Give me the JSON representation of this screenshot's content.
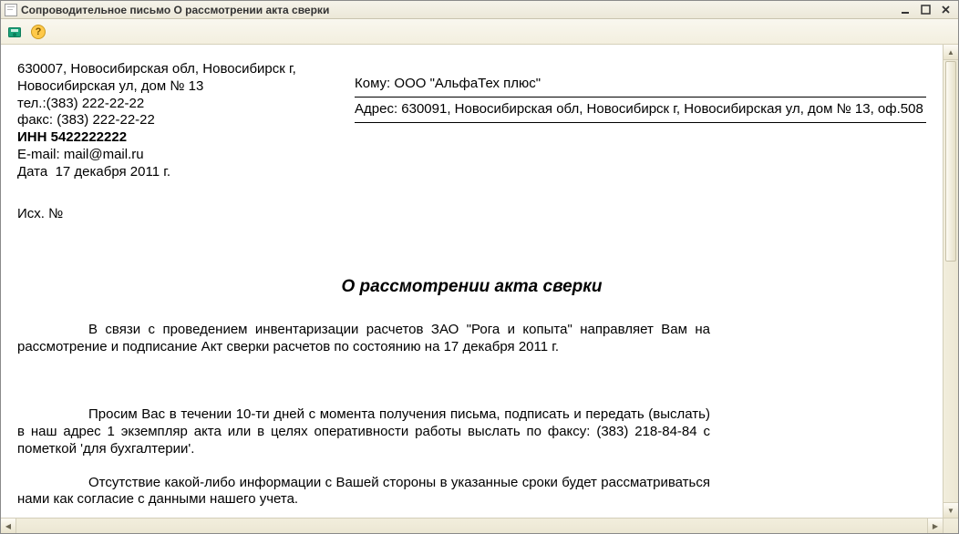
{
  "window": {
    "title": "Сопроводительное письмо О рассмотрении акта сверки"
  },
  "toolbar": {
    "save_name": "save-to-disk",
    "help_name": "help"
  },
  "sender": {
    "line1": "630007, Новосибирская обл, Новосибирск г,",
    "line2": "Новосибирская ул, дом № 13",
    "tel_label": "тел.:",
    "tel": "(383) 222-22-22",
    "fax_label": "факс:",
    "fax": "(383) 222-22-22",
    "inn_label": "ИНН",
    "inn": "5422222222",
    "email_label": "E-mail:",
    "email": "mail@mail.ru",
    "date_label": "Дата",
    "date": "17 декабря 2011 г."
  },
  "recipient": {
    "to_label": "Кому:",
    "to": "ООО \"АльфаТех плюс\"",
    "addr_label": "Адрес:",
    "addr": "630091, Новосибирская обл, Новосибирск г, Новосибирская ул, дом № 13, оф.508"
  },
  "ish": {
    "label": "Исх. №"
  },
  "heading": "О рассмотрении акта сверки",
  "body": {
    "p1": "В связи с проведением инвентаризации расчетов ЗАО \"Рога и копыта\" направляет Вам на рассмотрение и подписание Акт сверки расчетов  по состоянию на 17 декабря 2011 г.",
    "p2": "Просим Вас в течении 10-ти дней с момента получения письма, подписать и передать (выслать) в наш адрес 1 экземпляр акта или в целях оперативности работы выслать по факсу: (383) 218-84-84 с пометкой 'для бухгалтерии'.",
    "p3": "Отсутствие какой-либо информации с Вашей стороны в указанные сроки будет рассматриваться нами как согласие с данными нашего учета."
  }
}
